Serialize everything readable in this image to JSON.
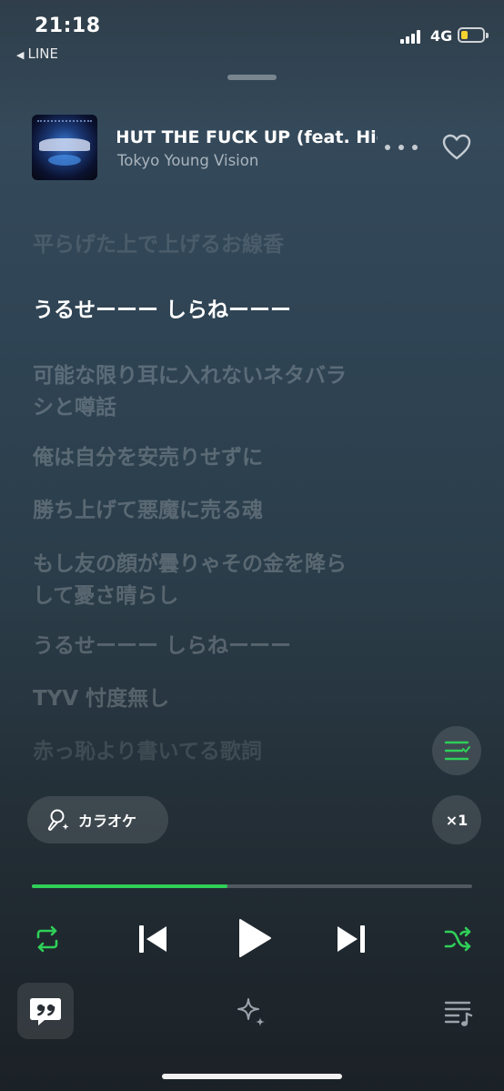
{
  "status_bar": {
    "time": "21:18",
    "back_app": "LINE",
    "network": "4G",
    "battery_level": 0.35,
    "battery_color": "#f7d330"
  },
  "track": {
    "title": "SHUT THE FUCK UP (feat. Hide",
    "artist": "Tokyo Young Vision",
    "album_art_icon": "album-cover-image"
  },
  "lyrics": [
    {
      "text": "平らげた上で上げるお線香",
      "state": "faded"
    },
    {
      "text": "うるせーーー しらねーーー",
      "state": "current"
    },
    {
      "text": "可能な限り耳に入れないネタバラシと噂話",
      "state": "upcoming"
    },
    {
      "text": "俺は自分を安売りせずに",
      "state": "upcoming"
    },
    {
      "text": "勝ち上げて悪魔に売る魂",
      "state": "upcoming"
    },
    {
      "text": "もし友の顔が曇りゃその金を降らして憂さ晴らし",
      "state": "upcoming"
    },
    {
      "text": "うるせーーー しらねーーー",
      "state": "upcoming"
    },
    {
      "text": "TYV 忖度無し",
      "state": "upcoming"
    },
    {
      "text": "赤っ恥より書いてる歌詞",
      "state": "faded"
    }
  ],
  "lyric_lines": {
    "l3a": "可能な限り耳に入れないネタバラ",
    "l3b": "シと噂話",
    "l6a": "もし友の顔が曇りゃその金を降ら",
    "l6b": "して憂さ晴らし"
  },
  "controls": {
    "karaoke_label": "カラオケ",
    "speed_label": "×1",
    "progress": 0.445,
    "accent_color": "#2fd058"
  },
  "icons": {
    "more": "more-dots-icon",
    "favorite": "heart-icon",
    "lyric_list": "lyric-list-icon",
    "karaoke": "microphone-icon",
    "repeat": "repeat-icon",
    "previous": "skip-previous-icon",
    "play": "play-icon",
    "next": "skip-next-icon",
    "shuffle": "shuffle-icon",
    "lyrics_tab": "quote-bubble-icon",
    "related_tab": "sparkle-icon",
    "queue_tab": "queue-music-icon"
  }
}
